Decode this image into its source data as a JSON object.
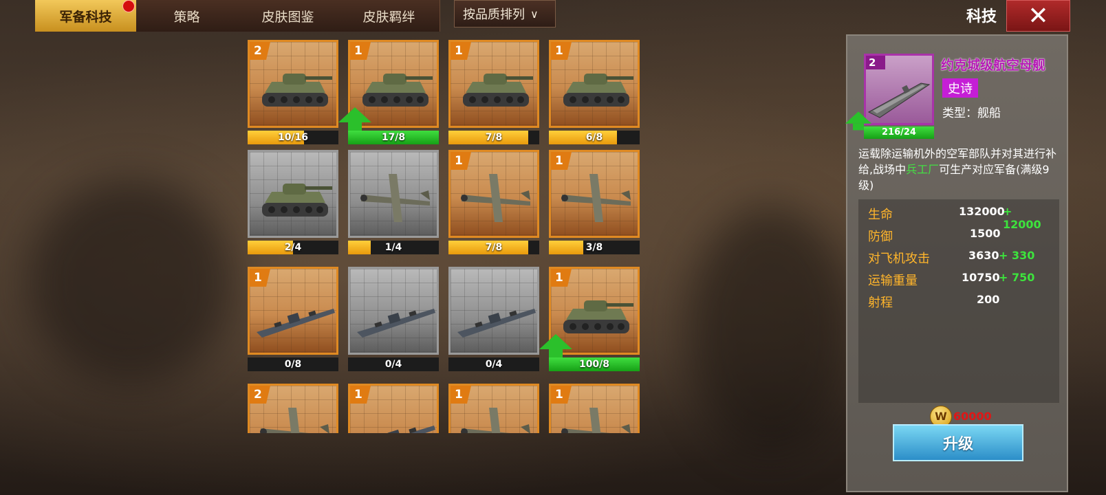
{
  "tabs": [
    {
      "label": "军备科技",
      "active": true,
      "has_notification": true
    },
    {
      "label": "策略",
      "active": false
    },
    {
      "label": "皮肤图鉴",
      "active": false
    },
    {
      "label": "皮肤羁绊",
      "active": false
    }
  ],
  "sort": {
    "label": "按品质排列"
  },
  "header": {
    "title": "科技",
    "close_icon": "close-x-icon"
  },
  "cards": [
    {
      "level": "2",
      "progress": "10/16",
      "fill": 0.62,
      "green": false,
      "locked": false,
      "unit": "tank",
      "upgrade_arrow": false
    },
    {
      "level": "1",
      "progress": "17/8",
      "fill": 1.0,
      "green": true,
      "locked": false,
      "unit": "tank",
      "upgrade_arrow": true
    },
    {
      "level": "1",
      "progress": "7/8",
      "fill": 0.88,
      "green": false,
      "locked": false,
      "unit": "tank",
      "upgrade_arrow": false
    },
    {
      "level": "1",
      "progress": "6/8",
      "fill": 0.75,
      "green": false,
      "locked": false,
      "unit": "tank",
      "upgrade_arrow": false
    },
    {
      "level": "",
      "progress": "2/4",
      "fill": 0.5,
      "green": false,
      "locked": true,
      "unit": "tank",
      "upgrade_arrow": false
    },
    {
      "level": "",
      "progress": "1/4",
      "fill": 0.25,
      "green": false,
      "locked": true,
      "unit": "plane",
      "upgrade_arrow": false
    },
    {
      "level": "1",
      "progress": "7/8",
      "fill": 0.88,
      "green": false,
      "locked": false,
      "unit": "plane",
      "upgrade_arrow": false
    },
    {
      "level": "1",
      "progress": "3/8",
      "fill": 0.38,
      "green": false,
      "locked": false,
      "unit": "plane",
      "upgrade_arrow": false
    },
    {
      "level": "1",
      "progress": "0/8",
      "fill": 0,
      "green": false,
      "locked": false,
      "unit": "ship",
      "upgrade_arrow": false
    },
    {
      "level": "",
      "progress": "0/4",
      "fill": 0,
      "green": false,
      "locked": true,
      "unit": "ship",
      "upgrade_arrow": false
    },
    {
      "level": "",
      "progress": "0/4",
      "fill": 0,
      "green": false,
      "locked": true,
      "unit": "ship",
      "upgrade_arrow": false
    },
    {
      "level": "1",
      "progress": "100/8",
      "fill": 1.0,
      "green": true,
      "locked": false,
      "unit": "tank",
      "upgrade_arrow": true
    },
    {
      "level": "2",
      "progress": "",
      "fill": 0,
      "green": false,
      "locked": false,
      "unit": "plane",
      "upgrade_arrow": false
    },
    {
      "level": "1",
      "progress": "",
      "fill": 0,
      "green": false,
      "locked": false,
      "unit": "ship",
      "upgrade_arrow": false
    },
    {
      "level": "1",
      "progress": "",
      "fill": 0,
      "green": false,
      "locked": false,
      "unit": "plane",
      "upgrade_arrow": false
    },
    {
      "level": "1",
      "progress": "",
      "fill": 0,
      "green": false,
      "locked": false,
      "unit": "plane",
      "upgrade_arrow": false
    }
  ],
  "detail": {
    "level": "2",
    "progress": "216/24",
    "name": "约克城级航空母舰",
    "quality": "史诗",
    "type": "类型：舰船",
    "desc_part1": "运载除运输机外的空军部队并对其进行补给,战场中",
    "desc_highlight": "兵工厂",
    "desc_part2": "可生产对应军备(满级9级)",
    "stats": [
      {
        "label": "生命",
        "value": "132000",
        "bonus": "+ 12000"
      },
      {
        "label": "防御",
        "value": "1500",
        "bonus": ""
      },
      {
        "label": "对飞机攻击",
        "value": "3630",
        "bonus": "+ 330"
      },
      {
        "label": "运输重量",
        "value": "10750",
        "bonus": "+ 750"
      },
      {
        "label": "射程",
        "value": "200",
        "bonus": ""
      }
    ],
    "cost": "60000",
    "coin_symbol": "W",
    "upgrade_label": "升级"
  }
}
